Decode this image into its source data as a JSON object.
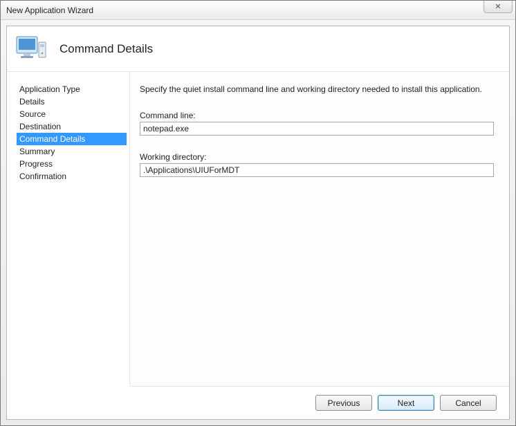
{
  "window": {
    "title": "New Application Wizard",
    "closeGlyph": "✕"
  },
  "header": {
    "title": "Command Details"
  },
  "sidebar": {
    "items": [
      {
        "label": "Application Type",
        "selected": false
      },
      {
        "label": "Details",
        "selected": false
      },
      {
        "label": "Source",
        "selected": false
      },
      {
        "label": "Destination",
        "selected": false
      },
      {
        "label": "Command Details",
        "selected": true
      },
      {
        "label": "Summary",
        "selected": false
      },
      {
        "label": "Progress",
        "selected": false
      },
      {
        "label": "Confirmation",
        "selected": false
      }
    ]
  },
  "content": {
    "instruction": "Specify the quiet install command line and working directory needed to install this application.",
    "commandLine": {
      "label": "Command line:",
      "value": "notepad.exe"
    },
    "workingDirectory": {
      "label": "Working directory:",
      "value": ".\\Applications\\UIUForMDT"
    }
  },
  "footer": {
    "previous": "Previous",
    "next": "Next",
    "cancel": "Cancel"
  }
}
